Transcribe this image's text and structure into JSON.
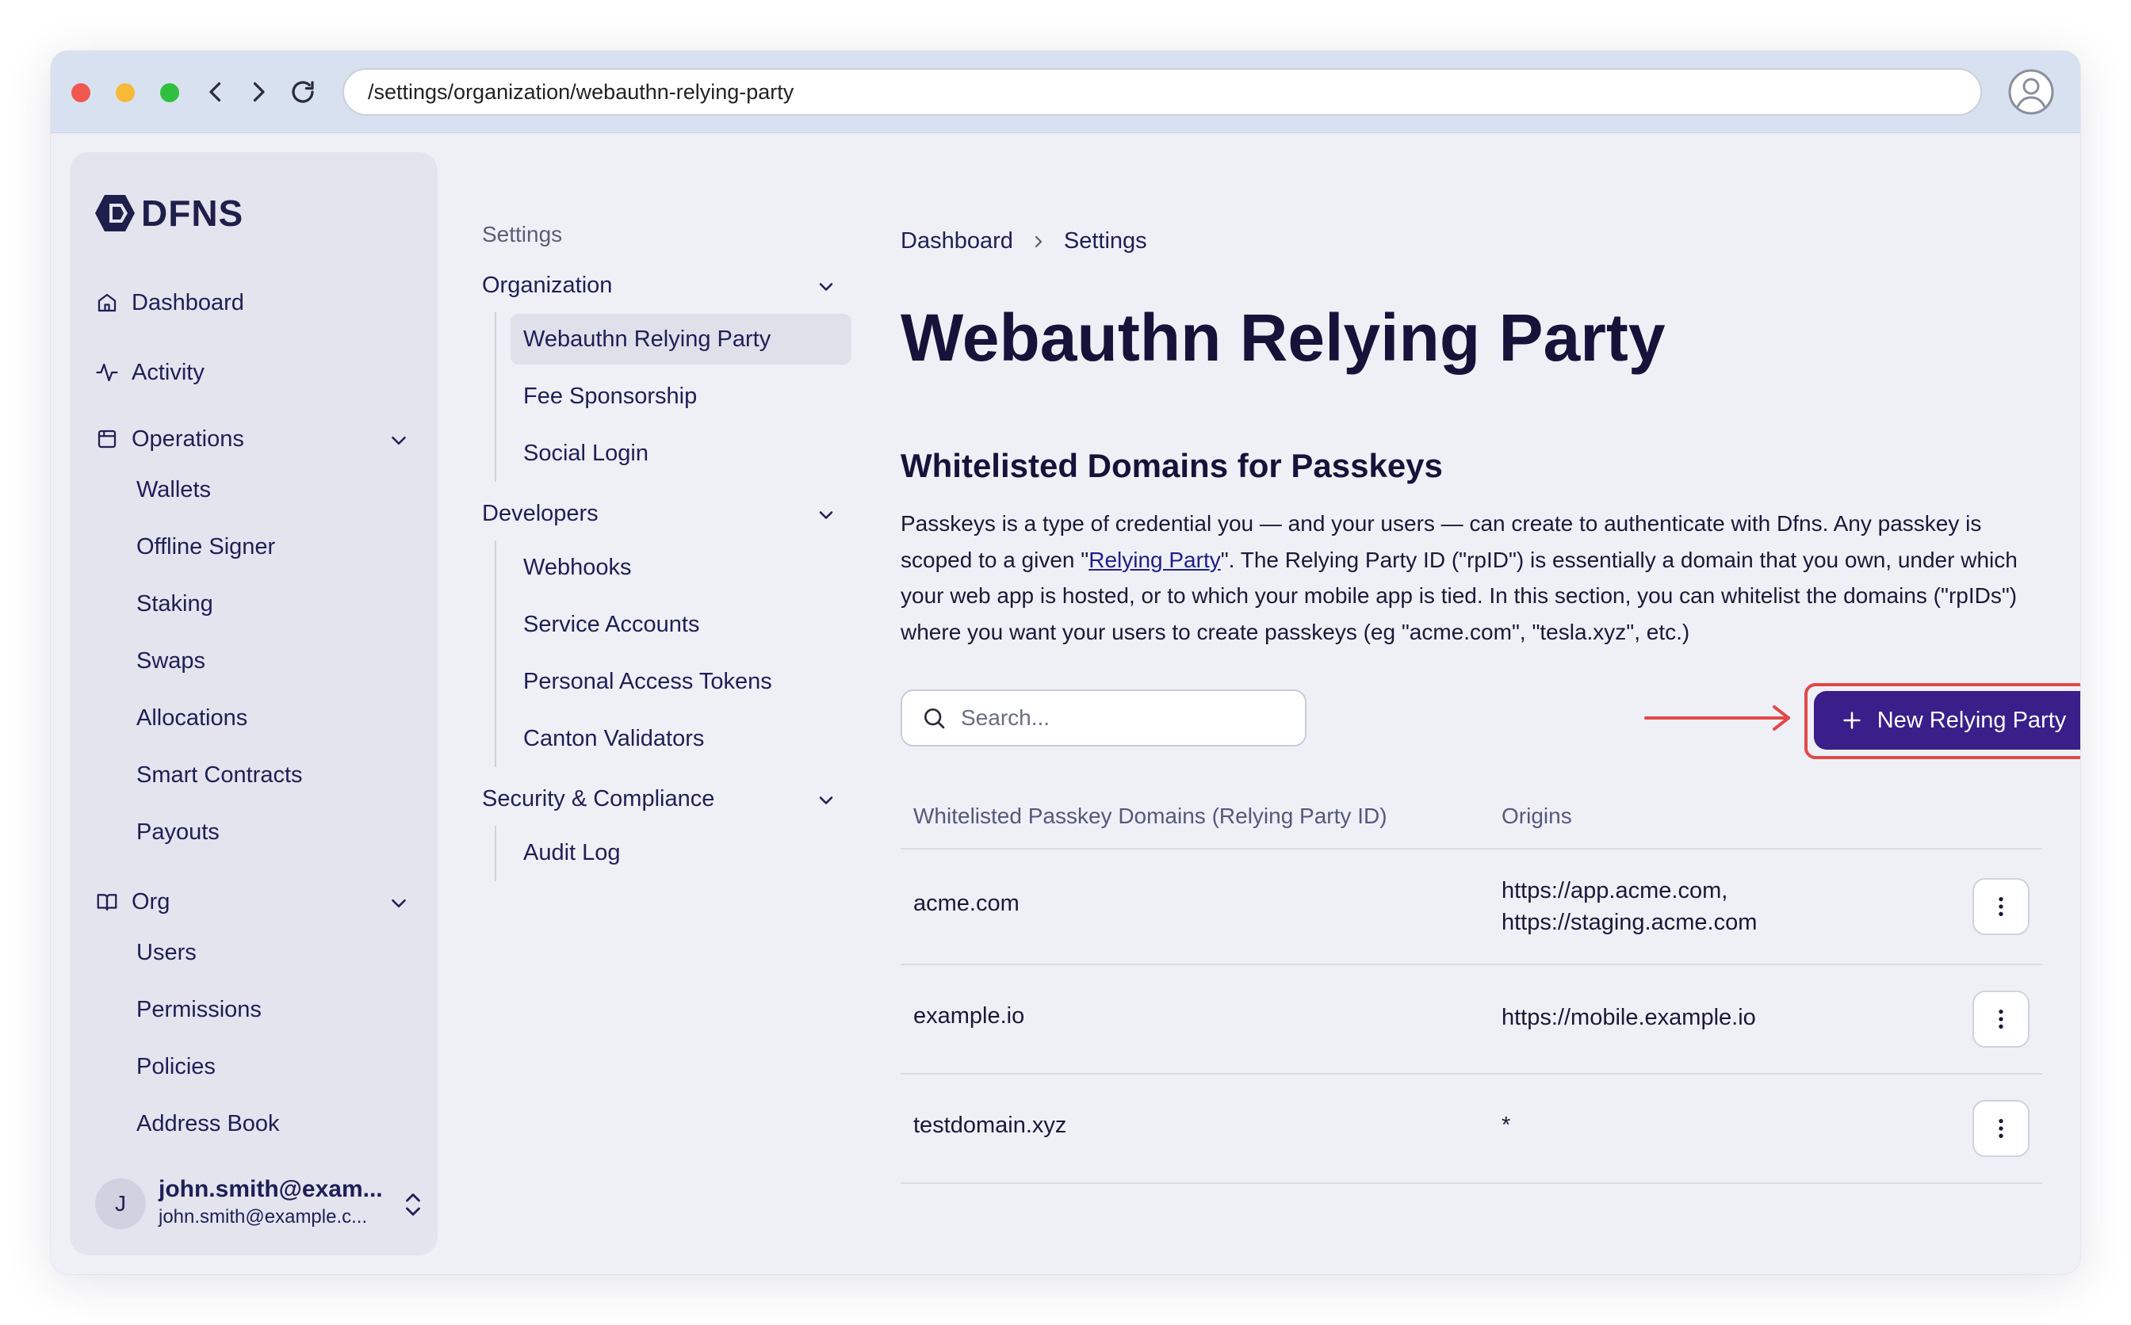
{
  "browser": {
    "url": "/settings/organization/webauthn-relying-party"
  },
  "sidebar": {
    "logo": "DFNS",
    "items": [
      {
        "label": "Dashboard",
        "icon": "home-icon"
      },
      {
        "label": "Activity",
        "icon": "activity-icon"
      },
      {
        "label": "Operations",
        "icon": "calendar-icon",
        "expanded": true,
        "children": [
          "Wallets",
          "Offline Signer",
          "Staking",
          "Swaps",
          "Allocations",
          "Smart Contracts",
          "Payouts"
        ]
      },
      {
        "label": "Org",
        "icon": "book-icon",
        "expanded": true,
        "children": [
          "Users",
          "Permissions",
          "Policies",
          "Address Book"
        ]
      }
    ],
    "user": {
      "initial": "J",
      "name": "john.smith@exam...",
      "email": "john.smith@example.c..."
    }
  },
  "subnav": {
    "heading": "Settings",
    "groups": [
      {
        "title": "Organization",
        "items": [
          "Webauthn Relying Party",
          "Fee Sponsorship",
          "Social Login"
        ],
        "active": "Webauthn Relying Party"
      },
      {
        "title": "Developers",
        "items": [
          "Webhooks",
          "Service Accounts",
          "Personal Access Tokens",
          "Canton Validators"
        ]
      },
      {
        "title": "Security & Compliance",
        "items": [
          "Audit Log"
        ]
      }
    ]
  },
  "main": {
    "breadcrumb": [
      "Dashboard",
      "Settings"
    ],
    "title": "Webauthn Relying Party",
    "section_title": "Whitelisted Domains for Passkeys",
    "description": {
      "before_link": "Passkeys is a type of credential you — and your users — can create to authenticate with Dfns. Any passkey is scoped to a given \"",
      "link": "Relying Party",
      "after_link": "\". The Relying Party ID (\"rpID\") is essentially a domain that you own, under which your web app is hosted, or to which your mobile app is tied. In this section, you can whitelist the domains (\"rpIDs\") where you want your users to create passkeys (eg \"acme.com\", \"tesla.xyz\", etc.)"
    },
    "search_placeholder": "Search...",
    "new_button": "New Relying Party",
    "table": {
      "headers": [
        "Whitelisted Passkey Domains (Relying Party ID)",
        "Origins"
      ],
      "rows": [
        {
          "domain": "acme.com",
          "origins": [
            "https://app.acme.com,",
            "https://staging.acme.com"
          ]
        },
        {
          "domain": "example.io",
          "origins": [
            "https://mobile.example.io"
          ]
        },
        {
          "domain": "testdomain.xyz",
          "origins": [
            "*"
          ]
        }
      ]
    }
  },
  "colors": {
    "accent": "#3a1e8a",
    "highlight": "#e14848",
    "text": "#1e1f55"
  }
}
